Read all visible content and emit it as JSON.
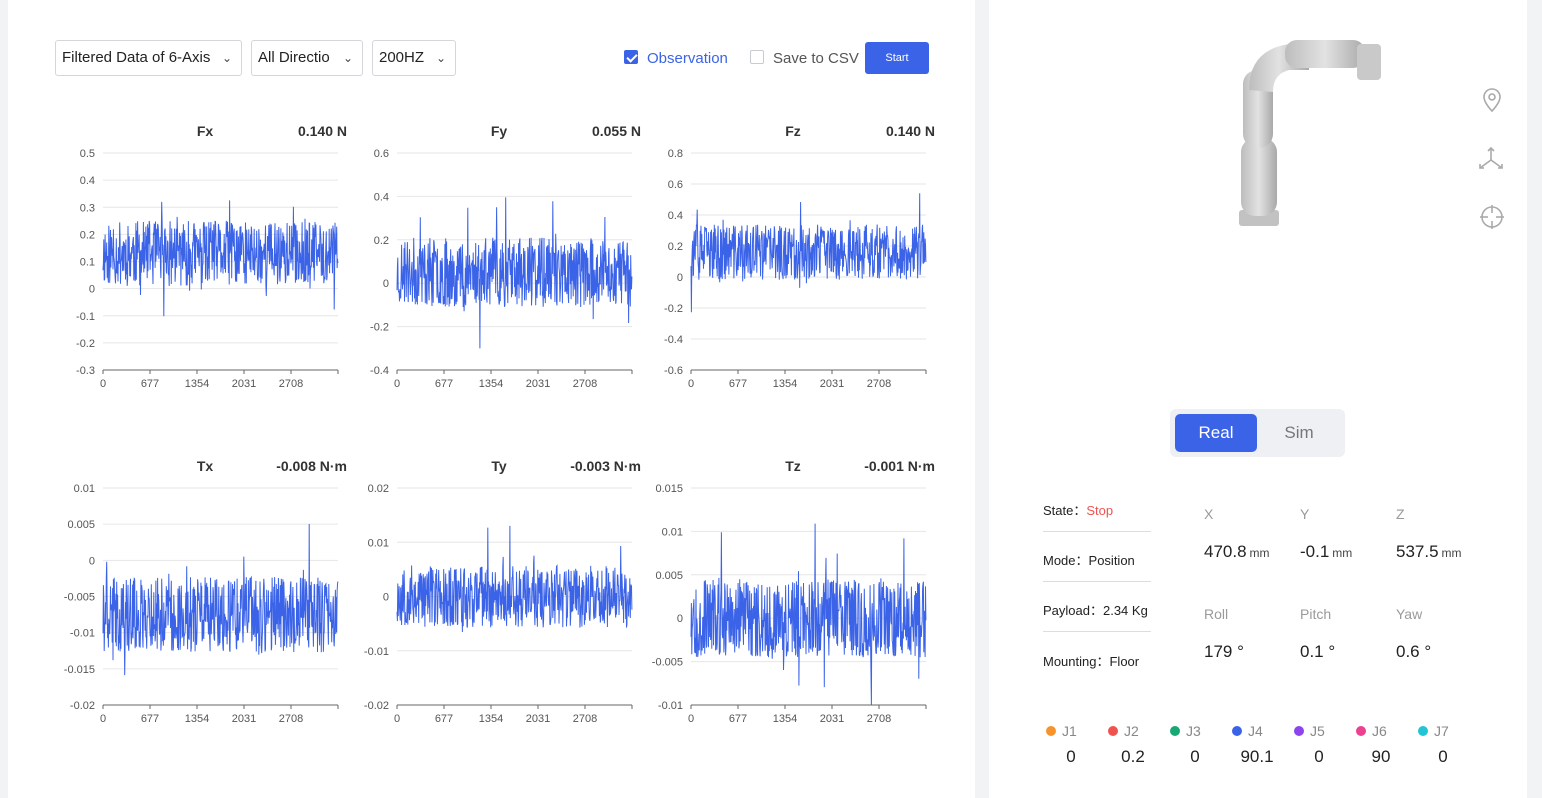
{
  "toolbar": {
    "data_select": "Filtered Data of 6-Axis",
    "direction_select": "All Directio",
    "rate_select": "200HZ",
    "observation_label": "Observation",
    "observation_checked": true,
    "csv_label": "Save to CSV",
    "csv_checked": false,
    "start_label": "Start"
  },
  "colors": {
    "accent": "#3b63e8",
    "line": "#3b63e8",
    "stop": "#ef5350"
  },
  "chart_data": [
    {
      "type": "line",
      "title": "Fx",
      "value": "0.140 N",
      "ylim": [
        -0.3,
        0.5
      ],
      "yticks": [
        "0.5",
        "0.4",
        "0.3",
        "0.2",
        "0.1",
        "0",
        "-0.1",
        "-0.2",
        "-0.3"
      ],
      "xticks": [
        "0",
        "677",
        "1354",
        "2031",
        "2708"
      ],
      "xlim": [
        0,
        3385
      ],
      "n_points": 3385,
      "mean": 0.13,
      "amplitude": 0.12,
      "noise_seed": 11
    },
    {
      "type": "line",
      "title": "Fy",
      "value": "0.055 N",
      "ylim": [
        -0.4,
        0.6
      ],
      "yticks": [
        "0.6",
        "0.4",
        "0.2",
        "0",
        "-0.2",
        "-0.4"
      ],
      "xticks": [
        "0",
        "677",
        "1354",
        "2031",
        "2708"
      ],
      "xlim": [
        0,
        3385
      ],
      "n_points": 3385,
      "mean": 0.05,
      "amplitude": 0.16,
      "noise_seed": 23
    },
    {
      "type": "line",
      "title": "Fz",
      "value": "0.140 N",
      "ylim": [
        -0.6,
        0.8
      ],
      "yticks": [
        "0.8",
        "0.6",
        "0.4",
        "0.2",
        "0",
        "-0.2",
        "-0.4",
        "-0.6"
      ],
      "xticks": [
        "0",
        "677",
        "1354",
        "2031",
        "2708"
      ],
      "xlim": [
        0,
        3385
      ],
      "n_points": 3385,
      "mean": 0.16,
      "amplitude": 0.18,
      "noise_seed": 37
    },
    {
      "type": "line",
      "title": "Tx",
      "value": "-0.008 N·m",
      "ylim": [
        -0.02,
        0.01
      ],
      "yticks": [
        "0.01",
        "0.005",
        "0",
        "-0.005",
        "-0.01",
        "-0.015",
        "-0.02"
      ],
      "xticks": [
        "0",
        "677",
        "1354",
        "2031",
        "2708"
      ],
      "xlim": [
        0,
        3385
      ],
      "n_points": 3385,
      "mean": -0.0075,
      "amplitude": 0.0052,
      "noise_seed": 41
    },
    {
      "type": "line",
      "title": "Ty",
      "value": "-0.003 N·m",
      "ylim": [
        -0.02,
        0.02
      ],
      "yticks": [
        "0.02",
        "0.01",
        "0",
        "-0.01",
        "-0.02"
      ],
      "xticks": [
        "0",
        "677",
        "1354",
        "2031",
        "2708"
      ],
      "xlim": [
        0,
        3385
      ],
      "n_points": 3385,
      "mean": 0.0,
      "amplitude": 0.0058,
      "noise_seed": 53
    },
    {
      "type": "line",
      "title": "Tz",
      "value": "-0.001 N·m",
      "ylim": [
        -0.01,
        0.015
      ],
      "yticks": [
        "0.015",
        "0.01",
        "0.005",
        "0",
        "-0.005",
        "-0.01"
      ],
      "xticks": [
        "0",
        "677",
        "1354",
        "2031",
        "2708"
      ],
      "xlim": [
        0,
        3385
      ],
      "n_points": 3385,
      "mean": 0.0,
      "amplitude": 0.0045,
      "noise_seed": 67
    }
  ],
  "view": {
    "real_label": "Real",
    "sim_label": "Sim",
    "active": "Real"
  },
  "status": {
    "state_label": "State：",
    "state_value": "Stop",
    "mode_label": "Mode：",
    "mode_value": "Position",
    "payload_label": "Payload：",
    "payload_value": "2.34 Kg",
    "mounting_label": "Mounting：",
    "mounting_value": "Floor"
  },
  "pose": {
    "x_label": "X",
    "x_value": "470.8",
    "x_unit": "mm",
    "y_label": "Y",
    "y_value": "-0.1",
    "y_unit": "mm",
    "z_label": "Z",
    "z_value": "537.5",
    "z_unit": "mm",
    "roll_label": "Roll",
    "roll_value": "179 °",
    "pitch_label": "Pitch",
    "pitch_value": "0.1 °",
    "yaw_label": "Yaw",
    "yaw_value": "0.6 °"
  },
  "joints": [
    {
      "label": "J1",
      "value": "0",
      "color": "#f7932b"
    },
    {
      "label": "J2",
      "value": "0.2",
      "color": "#ef5350"
    },
    {
      "label": "J3",
      "value": "0",
      "color": "#18a873"
    },
    {
      "label": "J4",
      "value": "90.1",
      "color": "#3b63e8"
    },
    {
      "label": "J5",
      "value": "0",
      "color": "#8e44ec"
    },
    {
      "label": "J6",
      "value": "90",
      "color": "#ec4191"
    },
    {
      "label": "J7",
      "value": "0",
      "color": "#22c4d6"
    }
  ],
  "icons": [
    "location-pin-icon",
    "axis-tripod-icon",
    "crosshair-icon"
  ]
}
